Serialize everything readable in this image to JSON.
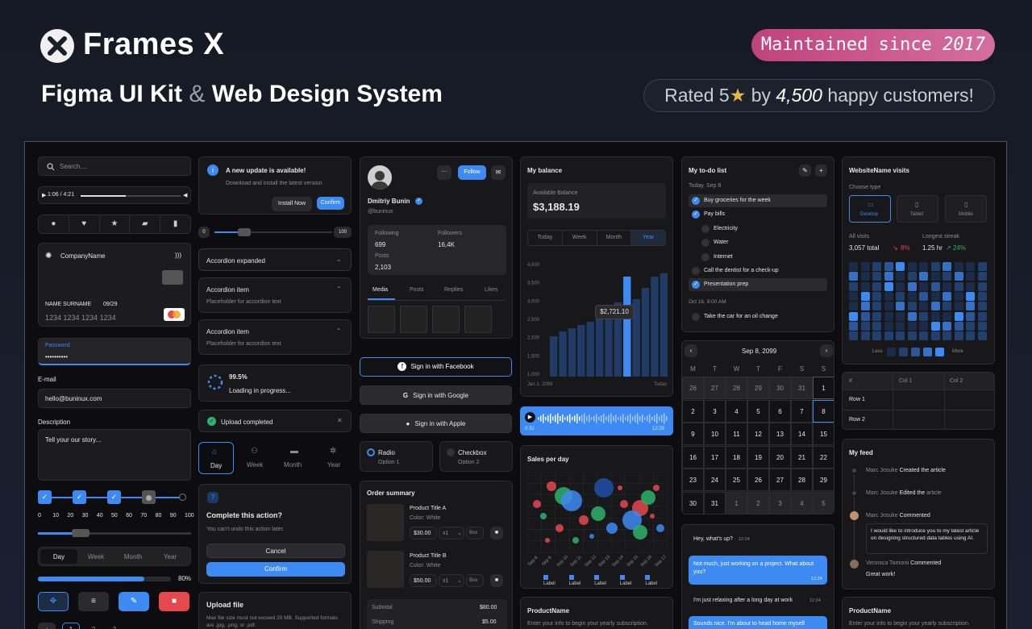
{
  "header": {
    "brand": "Frames X",
    "tagline_a": "Figma UI Kit",
    "tagline_amp": "&",
    "tagline_b": "Web Design System",
    "pill_text": "Maintained since",
    "pill_year": "2017",
    "rated_a": "Rated 5",
    "rated_star": "★",
    "rated_b": "by",
    "rated_count": "4,500",
    "rated_c": "happy customers!"
  },
  "col1": {
    "search_placeholder": "Search....",
    "audio_time": "1:06 / 4:21",
    "card_company": "CompanyName",
    "card_name": "NAME SURNAME",
    "card_exp": "09/29",
    "card_number": "1234 1234 1234 1234",
    "password_label": "Password",
    "password_value": "••••••••••",
    "email_label": "E-mail",
    "email_value": "hello@buninux.com",
    "desc_label": "Description",
    "desc_placeholder": "Tell your our story...",
    "ticks": [
      "0",
      "10",
      "20",
      "30",
      "40",
      "50",
      "60",
      "70",
      "80",
      "90",
      "100"
    ],
    "seg": [
      "Day",
      "Week",
      "Month",
      "Year"
    ],
    "progress_pct": "80%",
    "progress_value": 0.8,
    "pages": [
      "1",
      "2",
      "3"
    ]
  },
  "col2": {
    "update_title": "A new update is available!",
    "update_text": "Download and install the latest version",
    "install": "Install Now",
    "confirm": "Confirm",
    "range_min": "0",
    "range_max": "100",
    "acc1": "Accordion expanded",
    "acc2": "Accordion item",
    "acc2_text": "Placeholder for accordion text",
    "acc3": "Accordion item",
    "acc3_text": "Placeholder for accordion text",
    "load_pct": "99.5%",
    "load_text": "Loading in progress...",
    "upload_done": "Upload completed",
    "tabs": [
      "Day",
      "Week",
      "Month",
      "Year"
    ],
    "dialog_title": "Complete this action?",
    "dialog_text": "You can't undo this action later.",
    "cancel": "Cancel",
    "confirm2": "Confirm",
    "upload_title": "Upload file",
    "upload_text": "Max file size must not exceed 20 MB. Supported formats are .jpg, .png, or .pdf."
  },
  "col3": {
    "follow": "Follow",
    "name": "Dmitriy Bunin",
    "handle": "@buninux",
    "following_label": "Following",
    "following": "699",
    "followers_label": "Followers",
    "followers": "16,4K",
    "posts_label": "Posts",
    "posts": "2,103",
    "tabs": [
      "Media",
      "Posts",
      "Replies",
      "Likes"
    ],
    "fb": "Sign in with Facebook",
    "google": "Sign in with Google",
    "apple": "Sign in with Apple",
    "radio": "Radio",
    "radio_opt": "Option 1",
    "checkbox": "Checkbox",
    "checkbox_opt": "Option 2",
    "order_title": "Order summary",
    "p1": "Product Title A",
    "p1_color": "Color: White",
    "p1_price": "$30.00",
    "p1_qty": "x1",
    "p2": "Product Title B",
    "p2_color": "Color: White",
    "p2_price": "$50.00",
    "p2_qty": "x1",
    "box": "Box",
    "subtotal_label": "Subtotal",
    "subtotal": "$80.00",
    "shipping_label": "Shipping",
    "shipping": "$5.00"
  },
  "col4": {
    "balance_title": "My balance",
    "avail_label": "Available Balance",
    "avail": "$3,188.19",
    "periods": [
      "Today",
      "Week",
      "Month",
      "Year"
    ],
    "tooltip": "$2,721.10",
    "date_start": "Jan 1, 2099",
    "date_end": "Today",
    "audio_start": "0:32",
    "audio_end": "12:29",
    "sales_title": "Sales per day",
    "sales_x": [
      "Sep 8",
      "Sep 9",
      "Sep 10",
      "Sep 11",
      "Sep 12",
      "Sep 13",
      "Sep 14",
      "Sep 15",
      "Sep 16",
      "Sep 17"
    ],
    "legend": [
      "Label",
      "Label",
      "Label",
      "Label",
      "Label"
    ],
    "product_title": "ProductName",
    "product_text": "Enter your info to begin your yearly subscription."
  },
  "col5": {
    "todo_title": "My to-do list",
    "today": "Today, Sep 8",
    "items": [
      "Buy groceries for the week",
      "Pay bills",
      "Electricity",
      "Water",
      "Internet",
      "Call the dentist for a check-up",
      "Presentation prep"
    ],
    "later": "Oct 16, 9:00 AM",
    "later_item": "Take the car for an oil change",
    "cal_month": "Sep 8, 2099",
    "dows": [
      "M",
      "T",
      "W",
      "T",
      "F",
      "S",
      "S"
    ],
    "chat1": "Hey, what's up?",
    "chat1_t": "12:24",
    "chat2": "Not much, just working on a project. What about you?",
    "chat2_t": "12:24",
    "chat3": "I'm just relaxing after a long day at work",
    "chat3_t": "12:24",
    "chat4": "Sounds nice. I'm about to head home myself"
  },
  "col6": {
    "visits_title": "WebsiteName visits",
    "choose": "Choose type",
    "types": [
      "Desktop",
      "Tablet",
      "Mobile"
    ],
    "all_label": "All visits",
    "all": "3,057 total",
    "all_change": "8%",
    "streak_label": "Longest streak",
    "streak": "1.25 hr",
    "streak_change": "24%",
    "less": "Less",
    "more": "More",
    "table_head": [
      "#",
      "Col 1",
      "Col 2"
    ],
    "rows": [
      "Row 1",
      "Row 2"
    ],
    "feed_title": "My feed",
    "feed": [
      {
        "name": "Marc Josuke",
        "action": "Created the article"
      },
      {
        "name": "Marc Josuke",
        "action": "Edited the",
        "obj": "article"
      },
      {
        "name": "Marc Josuke",
        "action": "Commented",
        "quote": "I would like to introduce you to my latest article on designing structured data tables using AI."
      },
      {
        "name": "Veronica Tamonii",
        "action": "Commented",
        "quote": "Great work!"
      }
    ],
    "product_title": "ProductName",
    "product_text": "Enter your info to begin your yearly subscription."
  },
  "chart_data": {
    "type": "bar",
    "values": [
      25,
      28,
      30,
      32,
      34,
      36,
      40,
      46,
      62,
      48,
      55,
      62,
      64
    ],
    "highlight_index": 8,
    "yticks": [
      "4,000",
      "3,500",
      "3,000",
      "2,500",
      "2,000",
      "1,500",
      "1,000"
    ]
  },
  "colors": {
    "accent": "#3d8bf2",
    "pink": "#c0427c",
    "green": "#2db36a",
    "red": "#e5484d"
  }
}
